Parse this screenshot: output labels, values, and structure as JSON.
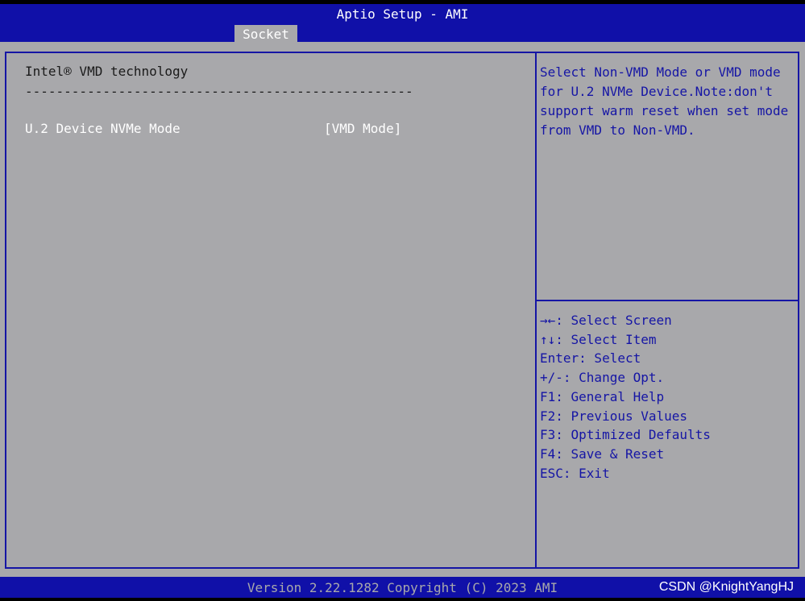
{
  "header": {
    "title": "Aptio Setup - AMI",
    "tabs": [
      {
        "label": "Socket",
        "active": true
      }
    ]
  },
  "main": {
    "section_title": "Intel® VMD technology",
    "separator": "--------------------------------------------------",
    "options": [
      {
        "label": "U.2 Device NVMe Mode",
        "value": "[VMD Mode]"
      }
    ]
  },
  "help": {
    "text": "Select Non-VMD Mode or VMD mode for U.2 NVMe Device.Note:don't support warm reset when set mode from VMD to Non-VMD."
  },
  "keys": [
    "→←: Select Screen",
    "↑↓: Select Item",
    "Enter: Select",
    "+/-: Change Opt.",
    "F1: General Help",
    "F2: Previous Values",
    "F3: Optimized Defaults",
    "F4: Save & Reset",
    "ESC: Exit"
  ],
  "footer": {
    "version": "Version 2.22.1282 Copyright (C) 2023 AMI",
    "watermark": "CSDN @KnightYangHJ"
  },
  "colors": {
    "header_bg": "#1010a8",
    "panel_bg": "#a8a8ab",
    "accent_blue": "#1515a5",
    "text_white": "#ffffff"
  }
}
